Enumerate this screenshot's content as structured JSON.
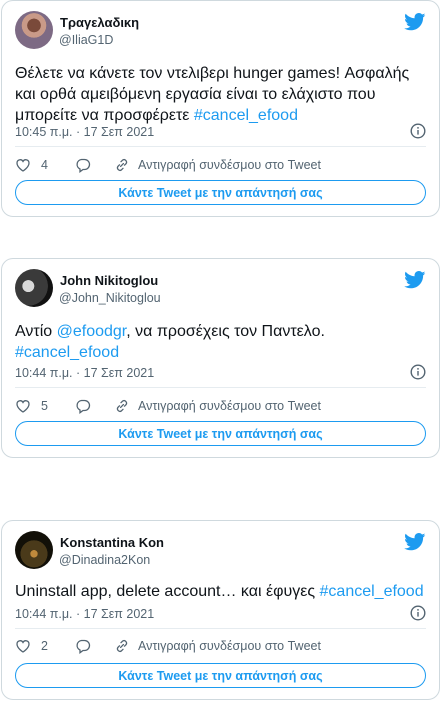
{
  "tweets": [
    {
      "name": "Τραγελαδικη",
      "handle": "@IliaG1D",
      "text_plain": "Θέλετε να κάνετε τον ντελιβερι hunger games! Ασφαλής και ορθά αμειβόμενη εργασία είναι το ελάχιστο που μπορείτε να προσφέρετε ",
      "hashtag": "#cancel_efood",
      "timestamp": "10:45 π.μ. · 17 Σεπ 2021",
      "likes": "4",
      "copy_link_label": "Αντιγραφή συνδέσμου στο Tweet",
      "reply_label": "Κάντε Tweet με την απάντησή σας"
    },
    {
      "name": "John Nikitoglou",
      "handle": "@John_Nikitoglou",
      "text_pre": "Αντίο ",
      "mention": "@efoodgr",
      "text_post": ", να προσέχεις τον Παντελο.",
      "hashtag": "#cancel_efood",
      "timestamp": "10:44 π.μ. · 17 Σεπ 2021",
      "likes": "5",
      "copy_link_label": "Αντιγραφή συνδέσμου στο Tweet",
      "reply_label": "Κάντε Tweet με την απάντησή σας"
    },
    {
      "name": "Konstantina Kon",
      "handle": "@Dinadina2Kon",
      "text_plain": "Uninstall app, delete account… και έφυγες ",
      "hashtag": "#cancel_efood",
      "timestamp": "10:44 π.μ. · 17 Σεπ 2021",
      "likes": "2",
      "copy_link_label": "Αντιγραφή συνδέσμου στο Tweet",
      "reply_label": "Κάντε Tweet με την απάντησή σας"
    }
  ],
  "colors": {
    "accent": "#1d9bf0",
    "text": "#0f1419",
    "muted": "#536471",
    "border": "#cfd9de"
  },
  "icons": [
    "twitter-bird-icon",
    "info-icon",
    "heart-icon",
    "reply-icon",
    "link-icon"
  ]
}
